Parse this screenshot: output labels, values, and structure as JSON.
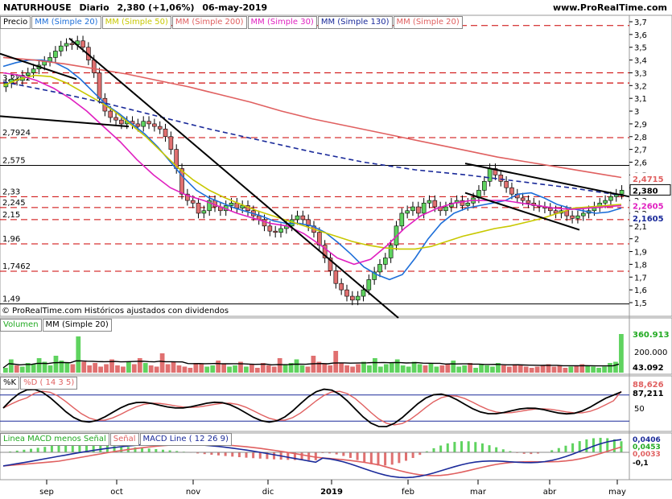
{
  "header": {
    "symbol": "NATURHOUSE",
    "period": "Diario",
    "quote": "2,380 (+1,06%)",
    "date": "06-may-2019",
    "site": "www.ProRealTime.com"
  },
  "legends": {
    "price": [
      {
        "label": "Precio",
        "color": "#000000"
      },
      {
        "label": "MM (Simple 20)",
        "color": "#1e6fd9"
      },
      {
        "label": "MM (Simple 50)",
        "color": "#c8c800"
      },
      {
        "label": "MM (Simple 200)",
        "color": "#e06060"
      },
      {
        "label": "MM (Simple 30)",
        "color": "#e020c0"
      },
      {
        "label": "MM (Simple 130)",
        "color": "#1a2a9a"
      },
      {
        "label": "MM (Simple 20)",
        "color": "#e06060"
      }
    ],
    "volume": [
      {
        "label": "Volumen",
        "color": "#22aa22"
      },
      {
        "label": "MM (Simple 20)",
        "color": "#000000"
      }
    ],
    "stoch": [
      {
        "label": "%K",
        "color": "#000000"
      },
      {
        "label": "%D ( 14 3 5)",
        "color": "#e06060"
      }
    ],
    "macd": [
      {
        "label": "Linea MACD menos Señal",
        "color": "#22aa22"
      },
      {
        "label": "Señal",
        "color": "#e06060"
      },
      {
        "label": "MACD Line ( 12 26 9)",
        "color": "#1a2a9a"
      }
    ]
  },
  "copyright": "© ProRealTime.com Históricos ajustados con dividendos",
  "chart_data": [
    {
      "type": "candlestick",
      "panel": "price",
      "ylim": [
        1.45,
        3.72
      ],
      "y_ticks": [
        "3,7",
        "3,6",
        "3,5",
        "3,4",
        "3,3",
        "3,2",
        "3,1",
        "3",
        "2,9",
        "2,8",
        "2,7",
        "2,6",
        "2,5",
        "2,4",
        "2,3",
        "2,2",
        "2,1",
        "2",
        "1,9",
        "1,8",
        "1,7",
        "1,6",
        "1,5"
      ],
      "x_labels": [
        "sep",
        "oct",
        "nov",
        "dic",
        "2019",
        "feb",
        "mar",
        "abr",
        "may"
      ],
      "closes": [
        3.22,
        3.25,
        3.24,
        3.28,
        3.3,
        3.33,
        3.36,
        3.39,
        3.42,
        3.47,
        3.51,
        3.53,
        3.52,
        3.55,
        3.5,
        3.4,
        3.3,
        3.1,
        3.0,
        2.95,
        2.93,
        2.9,
        2.92,
        2.9,
        2.88,
        2.92,
        2.9,
        2.88,
        2.86,
        2.8,
        2.7,
        2.55,
        2.35,
        2.3,
        2.28,
        2.2,
        2.22,
        2.3,
        2.25,
        2.22,
        2.26,
        2.28,
        2.24,
        2.26,
        2.22,
        2.18,
        2.15,
        2.1,
        2.06,
        2.05,
        2.08,
        2.1,
        2.15,
        2.18,
        2.15,
        2.1,
        2.05,
        1.95,
        1.85,
        1.75,
        1.65,
        1.6,
        1.55,
        1.52,
        1.55,
        1.6,
        1.68,
        1.74,
        1.8,
        1.85,
        1.95,
        2.1,
        2.2,
        2.22,
        2.25,
        2.2,
        2.28,
        2.3,
        2.25,
        2.22,
        2.25,
        2.28,
        2.3,
        2.26,
        2.28,
        2.32,
        2.38,
        2.45,
        2.55,
        2.5,
        2.45,
        2.4,
        2.35,
        2.32,
        2.3,
        2.28,
        2.26,
        2.25,
        2.24,
        2.22,
        2.2,
        2.22,
        2.18,
        2.16,
        2.18,
        2.2,
        2.22,
        2.25,
        2.28,
        2.3,
        2.33,
        2.35,
        2.38
      ],
      "horizontal_levels": [
        {
          "value": 2.7924,
          "label": "2,7924"
        },
        {
          "value": 2.575,
          "label": "2,575"
        },
        {
          "value": 2.33,
          "label": "2,33"
        },
        {
          "value": 2.245,
          "label": "2,245"
        },
        {
          "value": 2.15,
          "label": "2,15"
        },
        {
          "value": 1.96,
          "label": "1,96"
        },
        {
          "value": 1.7462,
          "label": "1,7462"
        },
        {
          "value": 1.49,
          "label": "1,49"
        },
        {
          "value": 3.22,
          "label": "3,2222"
        }
      ],
      "right_labels": [
        {
          "value": 2.4715,
          "label": "2,4715",
          "color": "#e06060"
        },
        {
          "value": 2.38,
          "label": "2,380",
          "color": "#000000"
        },
        {
          "value": 2.2605,
          "label": "2,2605",
          "color": "#e020c0"
        },
        {
          "value": 2.1605,
          "label": "2,1605",
          "color": "#1a2a9a"
        }
      ],
      "series": [
        {
          "name": "MM (Simple 20)",
          "color": "#1e6fd9",
          "values": [
            3.35,
            3.38,
            3.4,
            3.4,
            3.38,
            3.33,
            3.25,
            3.15,
            3.05,
            2.98,
            2.9,
            2.82,
            2.72,
            2.6,
            2.48,
            2.38,
            2.32,
            2.28,
            2.24,
            2.21,
            2.18,
            2.14,
            2.12,
            2.12,
            2.1,
            2.05,
            1.97,
            1.88,
            1.78,
            1.72,
            1.68,
            1.72,
            1.85,
            2.0,
            2.12,
            2.2,
            2.24,
            2.26,
            2.28,
            2.3,
            2.35,
            2.36,
            2.32,
            2.27,
            2.24,
            2.22,
            2.2,
            2.21,
            2.24
          ]
        },
        {
          "name": "MM (Simple 50)",
          "color": "#c8c800",
          "values": [
            3.2,
            3.25,
            3.28,
            3.27,
            3.22,
            3.15,
            3.08,
            3.0,
            2.9,
            2.8,
            2.68,
            2.56,
            2.46,
            2.38,
            2.32,
            2.27,
            2.22,
            2.18,
            2.14,
            2.1,
            2.06,
            2.02,
            1.98,
            1.95,
            1.93,
            1.92,
            1.92,
            1.94,
            1.98,
            2.02,
            2.05,
            2.08,
            2.1,
            2.13,
            2.16,
            2.2,
            2.24,
            2.25,
            2.26,
            2.27
          ]
        },
        {
          "name": "MM (Simple 30)",
          "color": "#e020c0",
          "values": [
            3.3,
            3.28,
            3.24,
            3.18,
            3.1,
            3.0,
            2.88,
            2.76,
            2.62,
            2.5,
            2.4,
            2.34,
            2.3,
            2.25,
            2.2,
            2.16,
            2.12,
            2.1,
            2.04,
            1.95,
            1.85,
            1.8,
            1.84,
            1.95,
            2.08,
            2.18,
            2.24,
            2.28,
            2.3,
            2.3,
            2.3,
            2.28,
            2.26,
            2.24,
            2.23,
            2.24,
            2.25,
            2.26
          ]
        },
        {
          "name": "MM (Simple 200)",
          "color": "#e06060",
          "values": [
            3.42,
            3.4,
            3.37,
            3.33,
            3.29,
            3.24,
            3.19,
            3.13,
            3.07,
            3.0,
            2.94,
            2.89,
            2.84,
            2.79,
            2.74,
            2.69,
            2.64,
            2.6,
            2.56,
            2.52,
            2.48
          ]
        },
        {
          "name": "MM (Simple 130)",
          "color": "#1a2a9a",
          "values": [
            3.23,
            3.15,
            3.06,
            2.96,
            2.86,
            2.77,
            2.68,
            2.6,
            2.54,
            2.5,
            2.45,
            2.4,
            2.34
          ]
        }
      ]
    },
    {
      "type": "bar",
      "panel": "volume",
      "y_ticks": [
        "200.000"
      ],
      "right_labels": [
        {
          "label": "360.913",
          "color": "#22aa22"
        },
        {
          "label": "43.092",
          "color": "#000000"
        }
      ],
      "values": [
        20,
        55,
        30,
        25,
        40,
        35,
        60,
        45,
        30,
        70,
        50,
        40,
        35,
        150,
        45,
        30,
        40,
        25,
        35,
        55,
        30,
        25,
        45,
        35,
        60,
        40,
        30,
        25,
        80,
        35,
        45,
        30,
        25,
        20,
        40,
        35,
        25,
        30,
        50,
        35,
        25,
        30,
        45,
        25,
        35,
        20,
        40,
        30,
        25,
        60,
        35,
        40,
        55,
        30,
        25,
        70,
        45,
        35,
        30,
        90,
        40,
        30,
        25,
        35,
        45,
        30,
        60,
        25,
        35,
        40,
        55,
        30,
        25,
        45,
        35,
        30,
        40,
        25,
        30,
        35,
        50,
        25,
        30,
        40,
        20,
        35,
        30,
        25,
        40,
        30,
        25,
        35,
        30,
        25,
        20,
        25,
        30,
        35,
        25,
        30,
        20,
        25,
        30,
        35,
        30,
        25,
        20,
        25,
        40,
        45,
        160
      ]
    },
    {
      "type": "line",
      "panel": "stochastic",
      "y_ticks": [
        "50"
      ],
      "right_labels": [
        {
          "label": "88,626",
          "color": "#e06060"
        },
        {
          "label": "87,211",
          "color": "#000000"
        }
      ],
      "series": [
        {
          "name": "%K",
          "color": "#000000"
        },
        {
          "name": "%D ( 14 3 5)",
          "color": "#e06060"
        }
      ]
    },
    {
      "type": "line",
      "panel": "macd",
      "y_ticks": [
        "0,0406",
        "0,0453",
        "0,0033",
        "-0,1"
      ],
      "series": [
        {
          "name": "MACD Line ( 12 26 9)",
          "color": "#1a2a9a"
        },
        {
          "name": "Señal",
          "color": "#e06060"
        },
        {
          "name": "Linea MACD menos Señal",
          "color": "#22aa22"
        }
      ]
    }
  ]
}
